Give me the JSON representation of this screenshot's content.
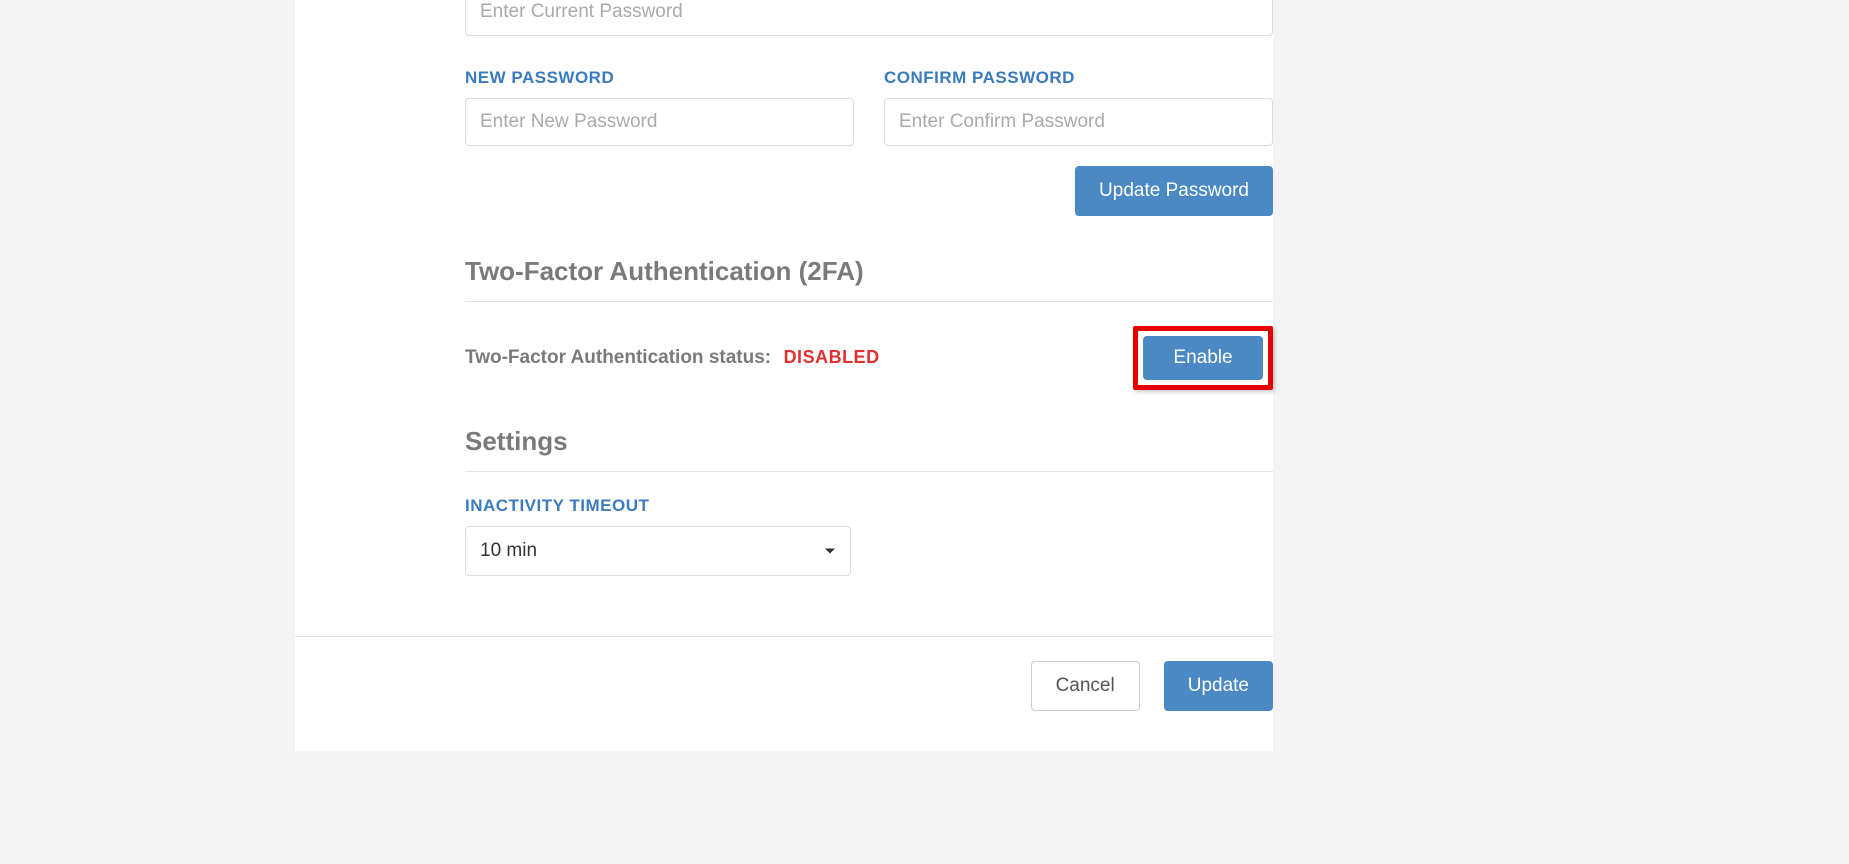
{
  "password": {
    "current_placeholder": "Enter Current Password",
    "new_label": "NEW PASSWORD",
    "new_placeholder": "Enter New Password",
    "confirm_label": "CONFIRM PASSWORD",
    "confirm_placeholder": "Enter Confirm Password",
    "update_button": "Update Password"
  },
  "twofa": {
    "heading": "Two-Factor Authentication (2FA)",
    "status_label": "Two-Factor Authentication status:",
    "status_value": "DISABLED",
    "enable_button": "Enable"
  },
  "settings": {
    "heading": "Settings",
    "inactivity_label": "INACTIVITY TIMEOUT",
    "inactivity_value": "10 min"
  },
  "footer": {
    "cancel": "Cancel",
    "update": "Update"
  }
}
